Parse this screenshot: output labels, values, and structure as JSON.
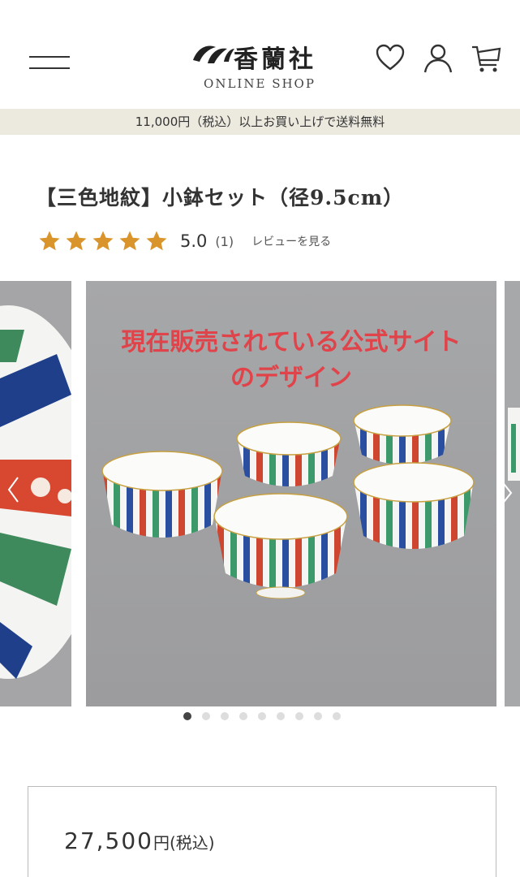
{
  "header": {
    "logo_kanji": "香蘭社",
    "logo_sub": "ONLINE SHOP"
  },
  "promo": {
    "text": "11,000円（税込）以上お買い上げで送料無料"
  },
  "product": {
    "title": "【三色地紋】小鉢セット（径9.5cm）",
    "rating": {
      "stars": 5,
      "score": "5.0",
      "count": "(1)",
      "review_link": "レビューを見る"
    },
    "overlay_text_line1": "現在販売されている公式サイト",
    "overlay_text_line2": "のデザイン",
    "gallery": {
      "slide_count": 9,
      "active_index": 0
    },
    "price": {
      "amount": "27,500",
      "unit": "円(税込)"
    }
  },
  "colors": {
    "accent_star": "#d9942b",
    "overlay_text": "#e0444a",
    "promo_bg": "#ece9df"
  }
}
